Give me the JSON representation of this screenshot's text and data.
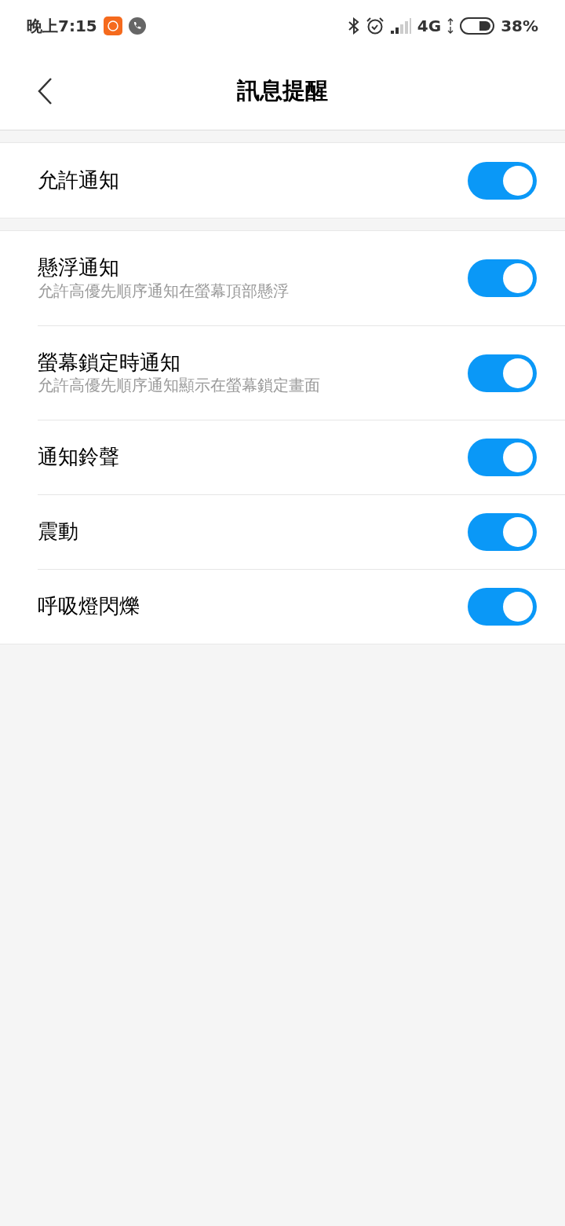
{
  "status_bar": {
    "time": "晚上7:15",
    "network": "4G",
    "battery": "38%"
  },
  "header": {
    "title": "訊息提醒"
  },
  "groups": [
    {
      "items": [
        {
          "title": "允許通知",
          "on": true
        }
      ]
    },
    {
      "items": [
        {
          "title": "懸浮通知",
          "subtitle": "允許高優先順序通知在螢幕頂部懸浮",
          "on": true
        },
        {
          "title": "螢幕鎖定時通知",
          "subtitle": "允許高優先順序通知顯示在螢幕鎖定畫面",
          "on": true
        },
        {
          "title": "通知鈴聲",
          "on": true
        },
        {
          "title": "震動",
          "on": true
        },
        {
          "title": "呼吸燈閃爍",
          "on": true
        }
      ]
    }
  ]
}
